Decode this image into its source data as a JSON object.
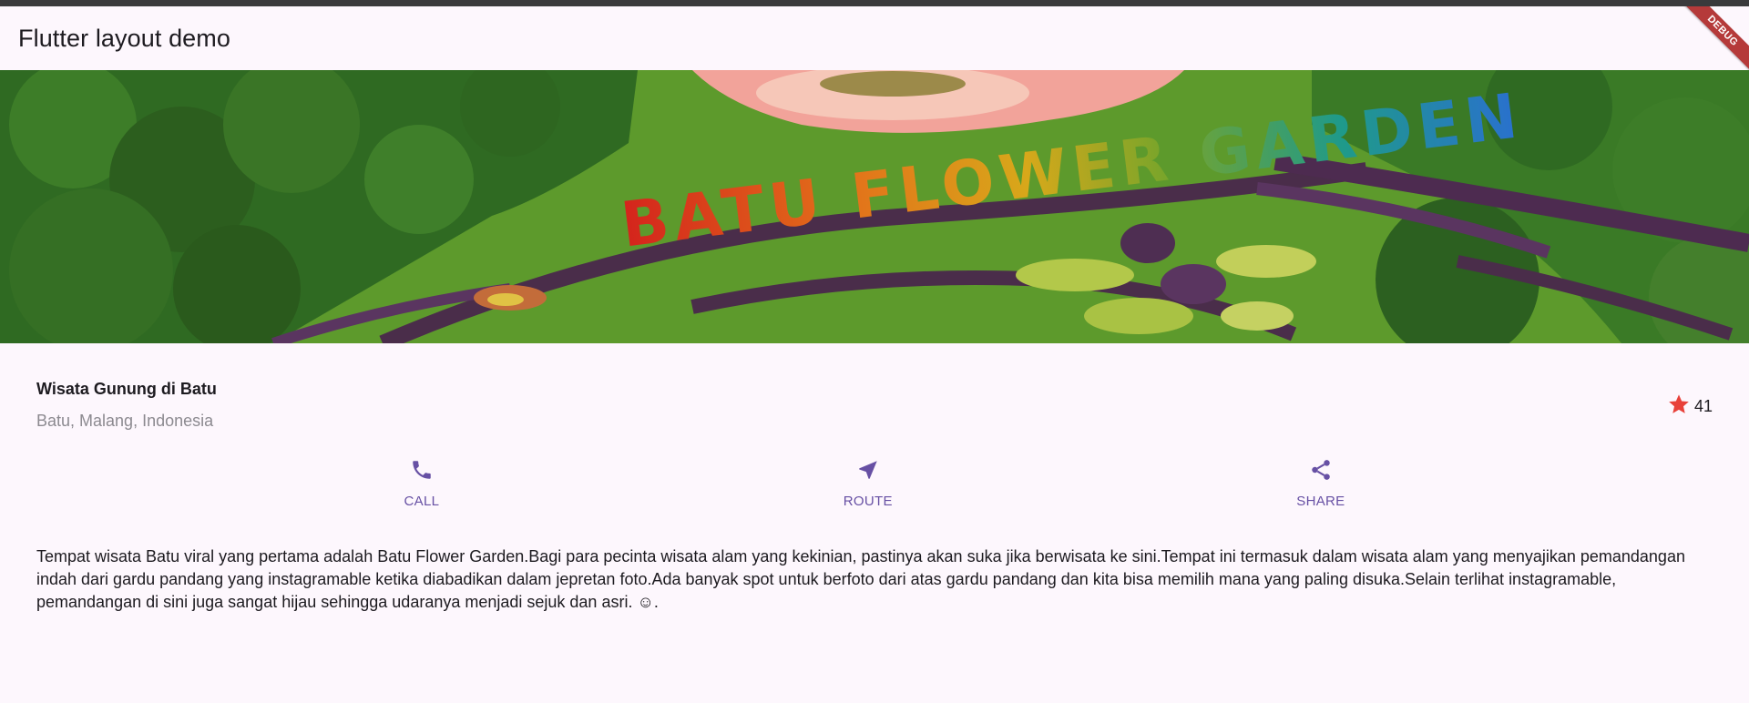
{
  "app": {
    "title": "Flutter layout demo",
    "debug_banner": "DEBUG"
  },
  "hero": {
    "sign_text": "BATU FLOWER GARDEN"
  },
  "location": {
    "name": "Wisata Gunung di Batu",
    "subtitle": "Batu, Malang, Indonesia",
    "rating": "41",
    "star_color": "#e8413a"
  },
  "actions": [
    {
      "label": "CALL",
      "icon": "phone-icon"
    },
    {
      "label": "ROUTE",
      "icon": "navigation-icon"
    },
    {
      "label": "SHARE",
      "icon": "share-icon"
    }
  ],
  "description": "Tempat wisata Batu viral yang pertama adalah Batu Flower Garden.Bagi para pecinta wisata alam yang kekinian, pastinya akan suka jika berwisata ke sini.Tempat ini termasuk dalam wisata alam yang menyajikan pemandangan indah dari gardu pandang yang instagramable ketika diabadikan dalam jepretan foto.Ada banyak spot untuk berfoto dari atas gardu pandang dan kita bisa memilih mana yang paling disuka.Selain terlihat instagramable, pemandangan di sini juga sangat hijau sehingga udaranya menjadi sejuk dan asri.  ☺.",
  "colors": {
    "accent": "#6750a4",
    "background": "#fdf7fd"
  }
}
